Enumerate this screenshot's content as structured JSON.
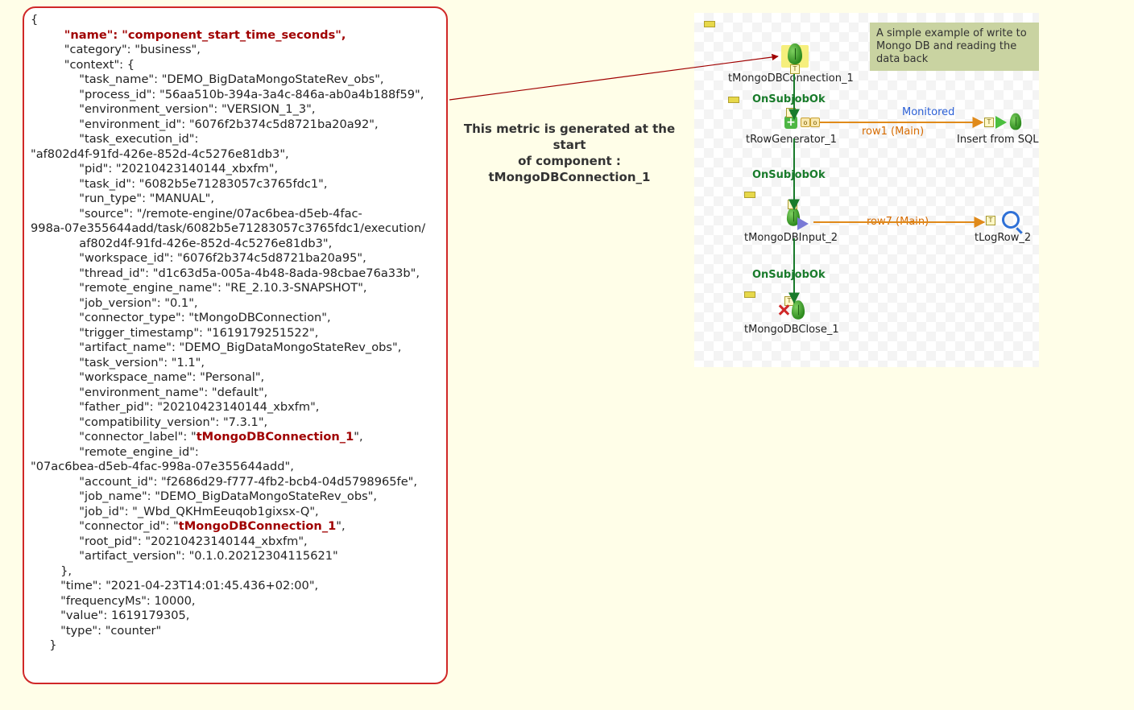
{
  "caption": {
    "line1": "This metric is generated at the start",
    "line2": "of component :",
    "line3": "tMongoDBConnection_1"
  },
  "note": "A simple example of write to Mongo DB and reading the data back",
  "flow": {
    "components": {
      "c1": "tMongoDBConnection_1",
      "c2": "tRowGenerator_1",
      "c3": "Insert from SQL",
      "c4": "tMongoDBInput_2",
      "c5": "tLogRow_2",
      "c6": "tMongoDBClose_1"
    },
    "subjob": "OnSubjobOk",
    "row1": "row1 (Main)",
    "row7": "row7 (Main)",
    "monitored": "Monitored"
  },
  "json_metric": {
    "name": "component_start_time_seconds",
    "category": "business",
    "context": {
      "task_name": "DEMO_BigDataMongoStateRev_obs",
      "process_id": "56aa510b-394a-3a4c-846a-ab0a4b188f59",
      "environment_version": "VERSION_1_3",
      "environment_id": "6076f2b374c5d8721ba20a92",
      "task_execution_id": "af802d4f-91fd-426e-852d-4c5276e81db3",
      "pid": "20210423140144_xbxfm",
      "task_id": "6082b5e71283057c3765fdc1",
      "run_type": "MANUAL",
      "source": "/remote-engine/07ac6bea-d5eb-4fac-998a-07e355644add/task/6082b5e71283057c3765fdc1/execution/af802d4f-91fd-426e-852d-4c5276e81db3",
      "workspace_id": "6076f2b374c5d8721ba20a95",
      "thread_id": "d1c63d5a-005a-4b48-8ada-98cbae76a33b",
      "remote_engine_name": "RE_2.10.3-SNAPSHOT",
      "job_version": "0.1",
      "connector_type": "tMongoDBConnection",
      "trigger_timestamp": "1619179251522",
      "artifact_name": "DEMO_BigDataMongoStateRev_obs",
      "task_version": "1.1",
      "workspace_name": "Personal",
      "environment_name": "default",
      "father_pid": "20210423140144_xbxfm",
      "compatibility_version": "7.3.1",
      "connector_label": "tMongoDBConnection_1",
      "remote_engine_id": "07ac6bea-d5eb-4fac-998a-07e355644add",
      "account_id": "f2686d29-f777-4fb2-bcb4-04d5798965fe",
      "job_name": "DEMO_BigDataMongoStateRev_obs",
      "job_id": "_Wbd_QKHmEeuqob1gixsx-Q",
      "connector_id": "tMongoDBConnection_1",
      "root_pid": "20210423140144_xbxfm",
      "artifact_version": "0.1.0.20212304115621"
    },
    "time": "2021-04-23T14:01:45.436+02:00",
    "frequencyMs": 10000,
    "value": 1619179305,
    "type": "counter"
  }
}
